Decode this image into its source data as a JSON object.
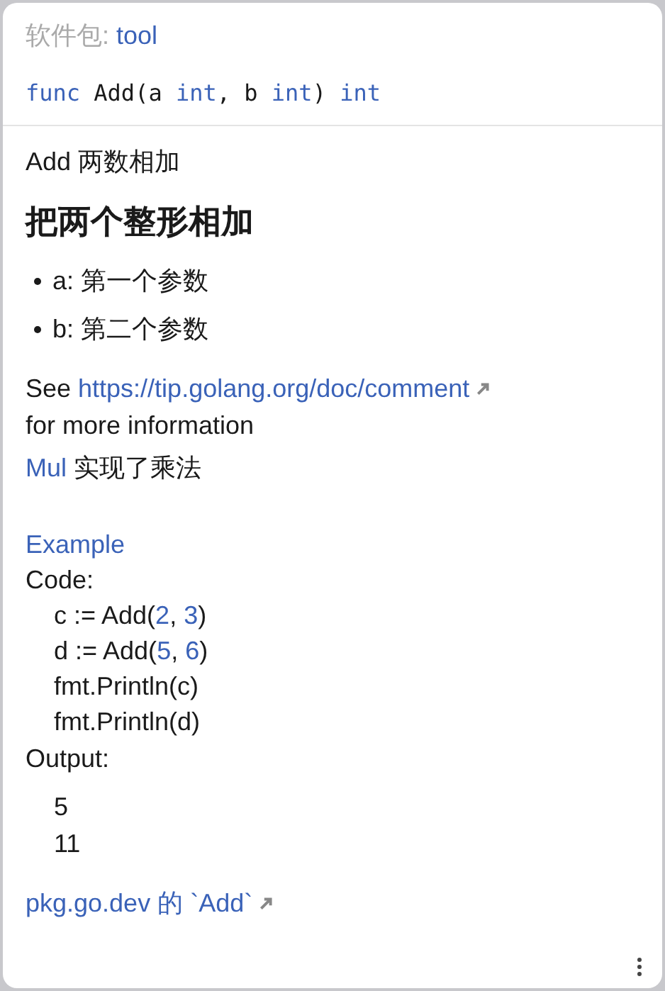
{
  "package": {
    "label": "软件包:",
    "name": "tool"
  },
  "signature": [
    {
      "text": "func",
      "kind": "keyword"
    },
    {
      "text": " Add(a ",
      "kind": "plain"
    },
    {
      "text": "int",
      "kind": "keyword"
    },
    {
      "text": ", b ",
      "kind": "plain"
    },
    {
      "text": "int",
      "kind": "keyword"
    },
    {
      "text": ") ",
      "kind": "plain"
    },
    {
      "text": "int",
      "kind": "keyword"
    }
  ],
  "summary": "Add 两数相加",
  "heading": "把两个整形相加",
  "bullets": [
    "a: 第一个参数",
    "b: 第二个参数"
  ],
  "see": {
    "prefix": "See",
    "link": "https://tip.golang.org/doc/comment",
    "suffix": "for more information"
  },
  "mul": {
    "link": "Mul",
    "text": "实现了乘法"
  },
  "example": {
    "title": "Example",
    "code_label": "Code:",
    "code_lines": [
      [
        {
          "text": "c := Add(",
          "kind": "plain"
        },
        {
          "text": "2",
          "kind": "number"
        },
        {
          "text": ", ",
          "kind": "plain"
        },
        {
          "text": "3",
          "kind": "number"
        },
        {
          "text": ")",
          "kind": "plain"
        }
      ],
      [
        {
          "text": "d := Add(",
          "kind": "plain"
        },
        {
          "text": "5",
          "kind": "number"
        },
        {
          "text": ", ",
          "kind": "plain"
        },
        {
          "text": "6",
          "kind": "number"
        },
        {
          "text": ")",
          "kind": "plain"
        }
      ],
      [
        {
          "text": "fmt.Println(c)",
          "kind": "plain"
        }
      ],
      [
        {
          "text": "fmt.Println(d)",
          "kind": "plain"
        }
      ]
    ],
    "output_label": "Output:",
    "output_lines": [
      "5",
      "11"
    ]
  },
  "footer_link": "pkg.go.dev 的 `Add`"
}
